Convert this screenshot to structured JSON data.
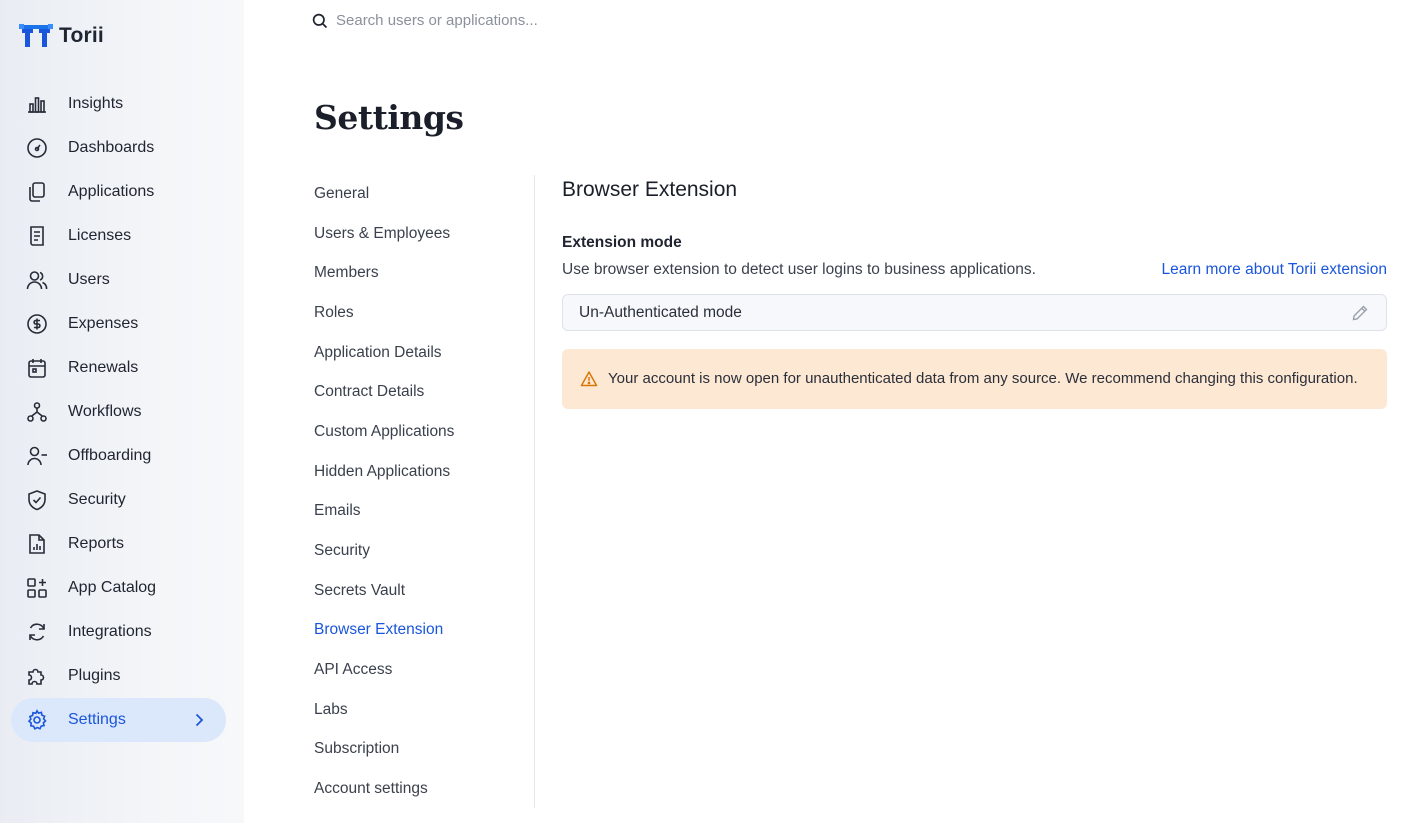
{
  "app": {
    "name": "Torii"
  },
  "search": {
    "placeholder": "Search users or applications..."
  },
  "sidebar": {
    "items": [
      {
        "label": "Insights",
        "icon": "bar-chart-icon"
      },
      {
        "label": "Dashboards",
        "icon": "gauge-icon"
      },
      {
        "label": "Applications",
        "icon": "copy-icon"
      },
      {
        "label": "Licenses",
        "icon": "receipt-icon"
      },
      {
        "label": "Users",
        "icon": "users-icon"
      },
      {
        "label": "Expenses",
        "icon": "dollar-circle-icon"
      },
      {
        "label": "Renewals",
        "icon": "calendar-icon"
      },
      {
        "label": "Workflows",
        "icon": "workflow-icon"
      },
      {
        "label": "Offboarding",
        "icon": "user-minus-icon"
      },
      {
        "label": "Security",
        "icon": "shield-check-icon"
      },
      {
        "label": "Reports",
        "icon": "report-icon"
      },
      {
        "label": "App Catalog",
        "icon": "grid-plus-icon"
      },
      {
        "label": "Integrations",
        "icon": "refresh-icon"
      },
      {
        "label": "Plugins",
        "icon": "puzzle-icon"
      },
      {
        "label": "Settings",
        "icon": "gear-icon",
        "active": true
      }
    ]
  },
  "page": {
    "title": "Settings"
  },
  "settings_nav": {
    "items": [
      "General",
      "Users & Employees",
      "Members",
      "Roles",
      "Application Details",
      "Contract Details",
      "Custom Applications",
      "Hidden Applications",
      "Emails",
      "Security",
      "Secrets Vault",
      "Browser Extension",
      "API Access",
      "Labs",
      "Subscription",
      "Account settings"
    ],
    "active": "Browser Extension"
  },
  "content": {
    "title": "Browser Extension",
    "field_label": "Extension mode",
    "description": "Use browser extension to detect user logins to business applications.",
    "learn_more": "Learn more about Torii extension",
    "mode_value": "Un-Authenticated mode",
    "warning": "Your account is now open for unauthenticated data from any source. We recommend changing this configuration."
  },
  "colors": {
    "accent": "#1a56db",
    "active_nav_bg": "#dbe7fb",
    "warning_bg": "#fde8d3",
    "warning_icon": "#d97706"
  }
}
